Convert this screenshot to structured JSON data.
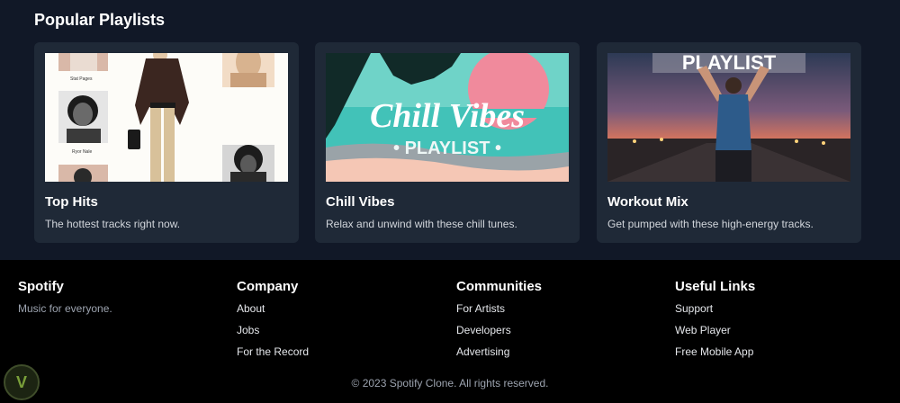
{
  "section": {
    "title": "Popular Playlists"
  },
  "playlists": [
    {
      "title": "Top Hits",
      "description": "The hottest tracks right now.",
      "image_texts": [
        "Stat Pages",
        "Ryor Nale"
      ]
    },
    {
      "title": "Chill Vibes",
      "description": "Relax and unwind with these chill tunes.",
      "image_texts": [
        "Chill Vibes",
        "• PLAYLIST •"
      ]
    },
    {
      "title": "Workout Mix",
      "description": "Get pumped with these high-energy tracks.",
      "image_texts": [
        "PLAYLIST"
      ]
    }
  ],
  "footer": {
    "brand": {
      "title": "Spotify",
      "tagline": "Music for everyone."
    },
    "columns": [
      {
        "title": "Company",
        "links": [
          "About",
          "Jobs",
          "For the Record"
        ]
      },
      {
        "title": "Communities",
        "links": [
          "For Artists",
          "Developers",
          "Advertising"
        ]
      },
      {
        "title": "Useful Links",
        "links": [
          "Support",
          "Web Player",
          "Free Mobile App"
        ]
      }
    ],
    "copyright": "© 2023 Spotify Clone. All rights reserved."
  },
  "badge": {
    "icon": "v-logo-icon",
    "letter": "V"
  }
}
